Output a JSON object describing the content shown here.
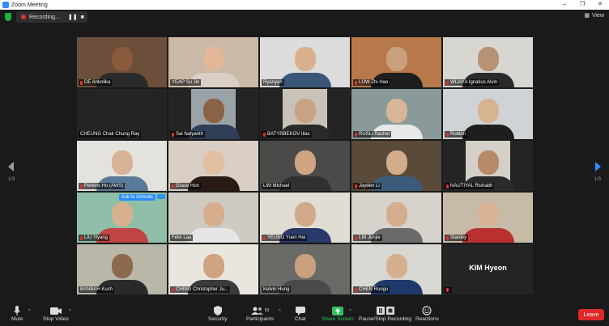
{
  "window": {
    "title": "Zoom Meeting",
    "controls": [
      "–",
      "❐",
      "✕"
    ]
  },
  "topbar": {
    "recording_label": "Recording...",
    "pause_glyph": "❚❚",
    "stop_glyph": "■",
    "view_label": "View"
  },
  "pager": {
    "left_label": "1/3",
    "right_label": "1/3"
  },
  "hover": {
    "ask_unmute": "Ask to Unmute",
    "more": "···"
  },
  "participants": [
    {
      "name": "DE Ankolika",
      "muted": true,
      "bg": "#6b4f3a",
      "skin": "#8a5a3c",
      "shirt": "#2a2a2a"
    },
    {
      "name": "YEAP Su Jin",
      "muted": false,
      "bg": "#c9b9a6",
      "skin": "#e2b899",
      "shirt": "#d9cfc4"
    },
    {
      "name": "Ryanyen",
      "muted": false,
      "bg": "#dcdcdc",
      "skin": "#d9b08c",
      "shirt": "#3a5678"
    },
    {
      "name": "LOW Zhi Hao",
      "muted": true,
      "bg": "#b7794a",
      "skin": "#c9a07c",
      "shirt": "#1e1e1e"
    },
    {
      "name": "WIJAYA Ignatius Alvin",
      "muted": true,
      "bg": "#d8d6d0",
      "skin": "#b89274",
      "shirt": "#2a2a2a"
    },
    {
      "name": "CHEUNG Chak Chung Ray",
      "muted": false,
      "type": "nameonly"
    },
    {
      "name": "Sai Nalyanth",
      "muted": true,
      "type": "blk",
      "bg": "#9aa3a8",
      "skin": "#8a6246",
      "shirt": "#2f3f58"
    },
    {
      "name": "BATYRBEKOV Ilias",
      "muted": true,
      "type": "blk",
      "bg": "#c9c2b6",
      "skin": "#c7a383",
      "shirt": "#2a2a2a"
    },
    {
      "name": "RUSLI Rachel",
      "muted": true,
      "bg": "#8a9a9a",
      "skin": "#d8b597",
      "shirt": "#e8e8e8"
    },
    {
      "name": "Robbin",
      "muted": true,
      "bg": "#cfd3d6",
      "skin": "#d6b391",
      "shirt": "#1e1e1e"
    },
    {
      "name": "Perkins Ho (AWS)",
      "muted": true,
      "bg": "#e4e2dc",
      "skin": "#d7b294",
      "shirt": "#5a7a9a"
    },
    {
      "name": "Grace Hon",
      "muted": true,
      "bg": "#d9cfc5",
      "skin": "#e3bfa1",
      "shirt": "#2a1a16"
    },
    {
      "name": "LIM Michael",
      "muted": false,
      "bg": "#4a4a48",
      "skin": "#cfa583",
      "shirt": "#303030"
    },
    {
      "name": "Jayden Li",
      "muted": true,
      "bg": "#5a4a3a",
      "skin": "#d2ac8b",
      "shirt": "#3c5a7a"
    },
    {
      "name": "NAUTIYAL Rishabh",
      "muted": true,
      "type": "blk",
      "bg": "#d4cfc8",
      "skin": "#b88a68",
      "shirt": "#2a2a2a"
    },
    {
      "name": "LIU Yiyang",
      "muted": true,
      "bg": "#8fbfa8",
      "skin": "#d7b090",
      "shirt": "#c04444"
    },
    {
      "name": "Felix Lau",
      "muted": false,
      "bg": "#cfcac2",
      "skin": "#d6ae8d",
      "shirt": "#e6e6e6"
    },
    {
      "name": "YEUNG Yuen Hei",
      "muted": true,
      "bg": "#e1ddd4",
      "skin": "#d0aa88",
      "shirt": "#2a3a6a"
    },
    {
      "name": "LIN Junjie",
      "muted": true,
      "bg": "#d7d3cc",
      "skin": "#d3ad8c",
      "shirt": "#6a6a6a"
    },
    {
      "name": "Stanley",
      "muted": true,
      "bg": "#c7bba8",
      "skin": "#d9b393",
      "shirt": "#b83030"
    },
    {
      "name": "BANBAH Kush",
      "muted": false,
      "bg": "#b9b8a8",
      "skin": "#8d6a4e",
      "shirt": "#2a2a2a"
    },
    {
      "name": "CHING Christopher Ju...",
      "muted": true,
      "bg": "#e9e6e0",
      "skin": "#cfa482",
      "shirt": "#3a3a3a"
    },
    {
      "name": "Kelvin Hung",
      "muted": false,
      "bg": "#6a6a66",
      "skin": "#c9a07e",
      "shirt": "#4a4a4a"
    },
    {
      "name": "CHEN Ruogu",
      "muted": true,
      "bg": "#d9d7d2",
      "skin": "#d5b08e",
      "shirt": "#1e3a6a"
    },
    {
      "name": "KIM Hyeon",
      "muted": true,
      "type": "nameonly",
      "big": true
    }
  ],
  "toolbar": {
    "mute": "Mute",
    "stop_video": "Stop Video",
    "security": "Security",
    "participants": "Participants",
    "participants_count": "63",
    "chat": "Chat",
    "share_screen": "Share Screen",
    "pause_recording": "Pause/Stop Recording",
    "reactions": "Reactions",
    "leave": "Leave"
  }
}
